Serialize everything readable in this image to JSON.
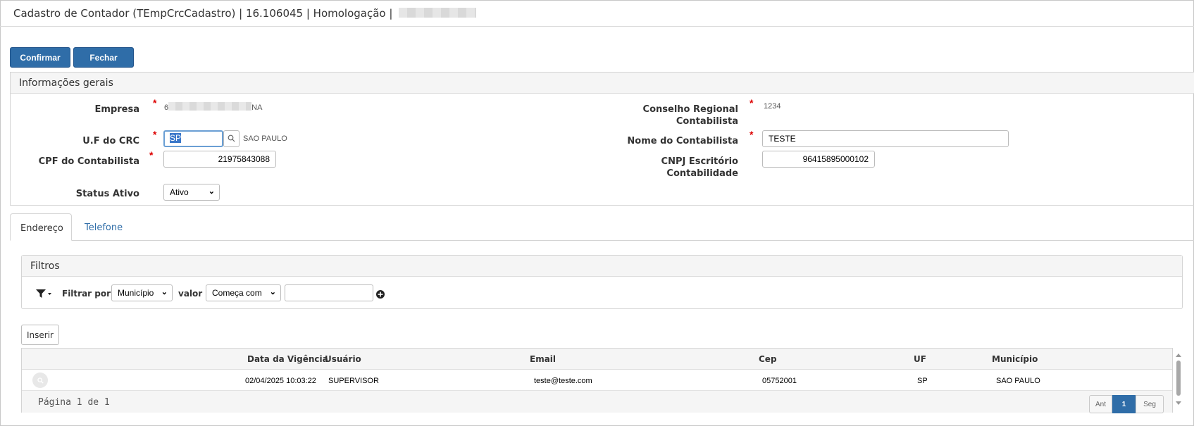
{
  "window": {
    "title": "Cadastro de Contador (TEmpCrcCadastro) | 16.106045 | Homologação |"
  },
  "toolbar": {
    "confirm_label": "Confirmar",
    "close_label": "Fechar"
  },
  "general_info": {
    "title": "Informações gerais",
    "empresa": {
      "label": "Empresa",
      "value_prefix": "6",
      "value_suffix": "NA"
    },
    "uf_crc": {
      "label": "U.F do CRC",
      "value": "SP",
      "description": "SAO PAULO"
    },
    "cpf": {
      "label": "CPF do Contabilista",
      "value": "21975843088"
    },
    "status": {
      "label": "Status Ativo",
      "value": "Ativo"
    },
    "conselho": {
      "label_line1": "Conselho Regional",
      "label_line2": "Contabilista",
      "value": "1234"
    },
    "nome": {
      "label": "Nome do Contabilista",
      "value": "TESTE"
    },
    "cnpj": {
      "label_line1": "CNPJ Escritório",
      "label_line2": "Contabilidade",
      "value": "96415895000102"
    }
  },
  "tabs": [
    {
      "label": "Endereço",
      "active": true
    },
    {
      "label": "Telefone",
      "active": false
    }
  ],
  "filters": {
    "title": "Filtros",
    "filter_by_label": "Filtrar por",
    "field_select": "Município",
    "value_label": "valor",
    "operator_select": "Começa com",
    "value_input": ""
  },
  "insert_label": "Inserir",
  "table": {
    "columns": [
      "Data da Vigência",
      "Usuário",
      "Email",
      "Cep",
      "UF",
      "Município"
    ],
    "rows": [
      {
        "data_vigencia": "02/04/2025 10:03:22",
        "usuario": "SUPERVISOR",
        "email": "teste@teste.com",
        "cep": "05752001",
        "uf": "SP",
        "municipio": "SAO PAULO"
      }
    ]
  },
  "pagination": {
    "summary": "Página 1 de 1",
    "prev_label": "Ant",
    "current_page": "1",
    "next_label": "Seg"
  },
  "colors": {
    "primary": "#2f6da8",
    "required": "#dd0000",
    "panel_header": "#f5f5f5"
  }
}
